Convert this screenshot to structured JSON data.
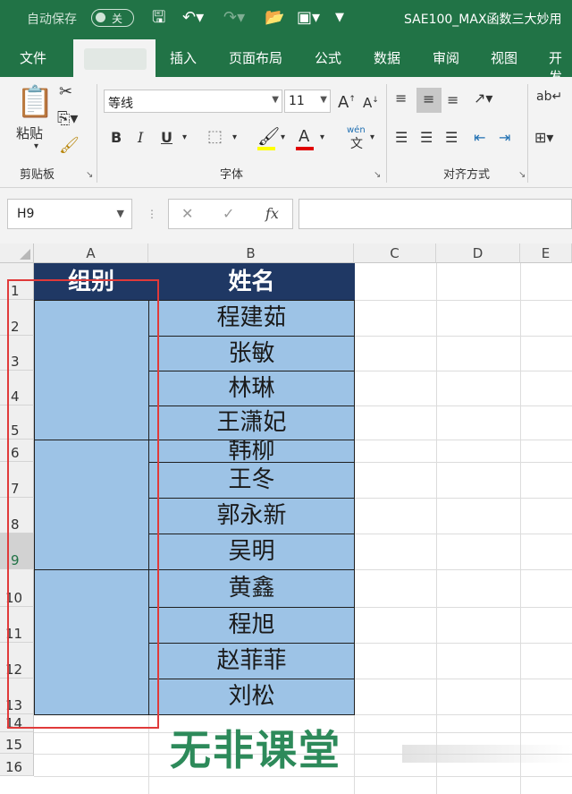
{
  "titlebar": {
    "autosave_label": "自动保存",
    "autosave_state": "关",
    "document_title": "SAE100_MAX函数三大妙用",
    "icons": [
      "save-icon",
      "undo-icon",
      "redo-icon",
      "open-folder-icon",
      "touch-mode-icon",
      "customize-quick-access-icon"
    ]
  },
  "tabs": [
    "文件",
    "插入",
    "页面布局",
    "公式",
    "数据",
    "审阅",
    "视图",
    "开发"
  ],
  "ribbon": {
    "clipboard": {
      "paste_label": "粘贴",
      "group_label": "剪贴板"
    },
    "font": {
      "font_name": "等线",
      "font_size": "11",
      "group_label": "字体",
      "wen_label": "wén",
      "wen_char": "文"
    },
    "alignment": {
      "group_label": "对齐方式"
    }
  },
  "formula_bar": {
    "name_box": "H9",
    "fx_label": "fx",
    "value": ""
  },
  "sheet": {
    "columns": [
      "A",
      "B",
      "C",
      "D",
      "E"
    ],
    "rows": [
      "1",
      "2",
      "3",
      "4",
      "5",
      "6",
      "7",
      "8",
      "9",
      "10",
      "11",
      "12",
      "13",
      "14",
      "15",
      "16"
    ],
    "selected_row": "9",
    "header_a": "组别",
    "header_b": "姓名",
    "names": [
      "程建茹",
      "张敏",
      "林琳",
      "王潇妃",
      "韩柳",
      "王冬",
      "郭永新",
      "吴明",
      "黄鑫",
      "程旭",
      "赵菲菲",
      "刘松"
    ]
  },
  "colors": {
    "excel_green": "#217346",
    "header_navy": "#1f3864",
    "cell_blue": "#9dc3e6",
    "highlight_red": "#e03a3a"
  },
  "watermark": "无非课堂"
}
